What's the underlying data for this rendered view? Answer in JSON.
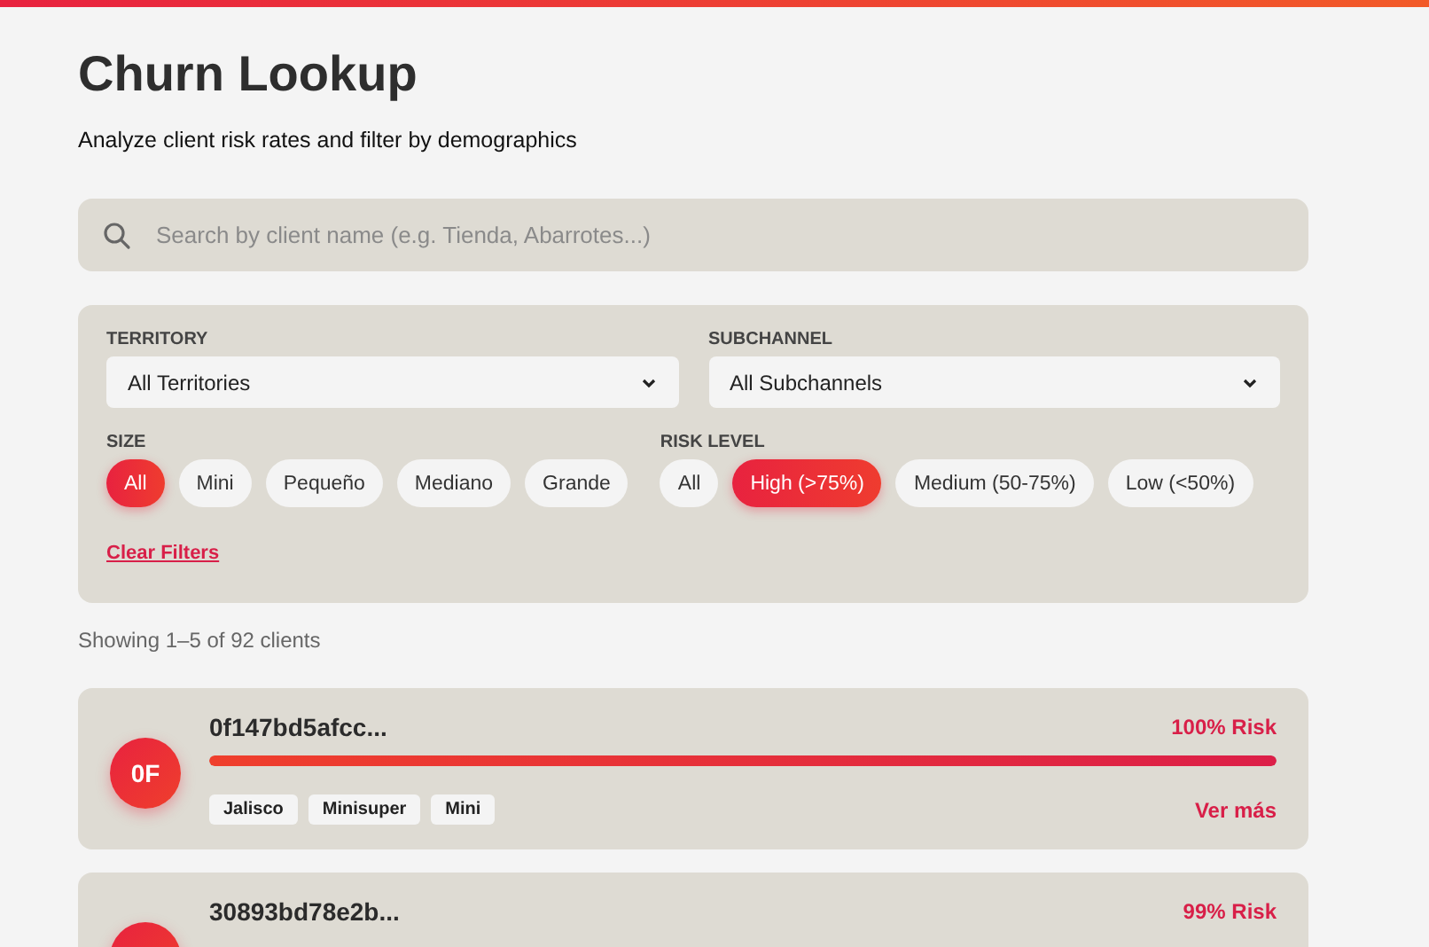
{
  "header": {
    "title": "Churn Lookup",
    "subtitle": "Analyze client risk rates and filter by demographics"
  },
  "search": {
    "placeholder": "Search by client name (e.g. Tienda, Abarrotes...)"
  },
  "filters": {
    "territory": {
      "label": "TERRITORY",
      "value": "All Territories"
    },
    "subchannel": {
      "label": "SUBCHANNEL",
      "value": "All Subchannels"
    },
    "size": {
      "label": "SIZE",
      "options": [
        {
          "label": "All",
          "selected": true
        },
        {
          "label": "Mini",
          "selected": false
        },
        {
          "label": "Pequeño",
          "selected": false
        },
        {
          "label": "Mediano",
          "selected": false
        },
        {
          "label": "Grande",
          "selected": false
        }
      ]
    },
    "risk_level": {
      "label": "RISK LEVEL",
      "options": [
        {
          "label": "All",
          "selected": false
        },
        {
          "label": "High (>75%)",
          "selected": true
        },
        {
          "label": "Medium (50-75%)",
          "selected": false
        },
        {
          "label": "Low (<50%)",
          "selected": false
        }
      ]
    },
    "clear_link": "Clear Filters"
  },
  "results_summary": "Showing 1–5 of 92 clients",
  "clients": [
    {
      "initials": "0F",
      "name": "0f147bd5afcc...",
      "risk": "100% Risk",
      "level": 1.0,
      "tags": [
        "Jalisco",
        "Minisuper",
        "Mini"
      ],
      "link": "Ver más"
    },
    {
      "name": "30893bd78e2b...",
      "risk": "99% Risk"
    }
  ]
}
